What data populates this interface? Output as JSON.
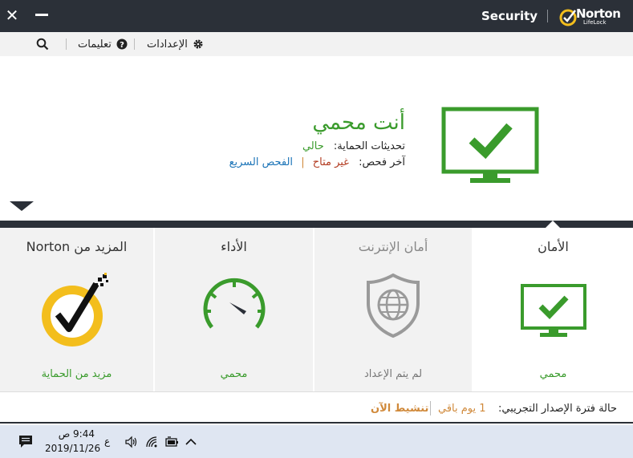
{
  "titlebar": {
    "app_title": "Security",
    "brand_name": "Norton",
    "brand_sub": "LifeLock"
  },
  "menubar": {
    "settings_label": "الإعدادات",
    "help_label": "تعليمات"
  },
  "hero": {
    "status_title": "أنت محمي",
    "updates_label": "تحديثات الحماية:",
    "updates_value": "حالي",
    "last_scan_label": "آخر فحص:",
    "last_scan_value": "غير متاح",
    "quick_scan_link": "الفحص السريع"
  },
  "tiles": [
    {
      "title": "الأمان",
      "status": "محمي"
    },
    {
      "title": "أمان الإنترنت",
      "status": "لم يتم الإعداد"
    },
    {
      "title": "الأداء",
      "status": "محمي"
    },
    {
      "title": "المزيد من Norton",
      "status": "مزيد من الحماية"
    }
  ],
  "trial": {
    "label": "حالة فترة الإصدار التجريبي:",
    "days_left": "1 يوم باقي",
    "activate_label": "تنشيط الآن"
  },
  "taskbar": {
    "time": "9:44 ص",
    "date": "2019/11/26",
    "language": "ع"
  },
  "colors": {
    "accent_green": "#3a9b2c",
    "dark_bar": "#2b3038",
    "orange": "#d0893a",
    "norton_yellow": "#f3be1d"
  },
  "icons": {
    "close": "close-icon",
    "minimize": "minimize-icon",
    "search": "search-icon",
    "help": "help-icon",
    "settings": "gear-icon"
  }
}
